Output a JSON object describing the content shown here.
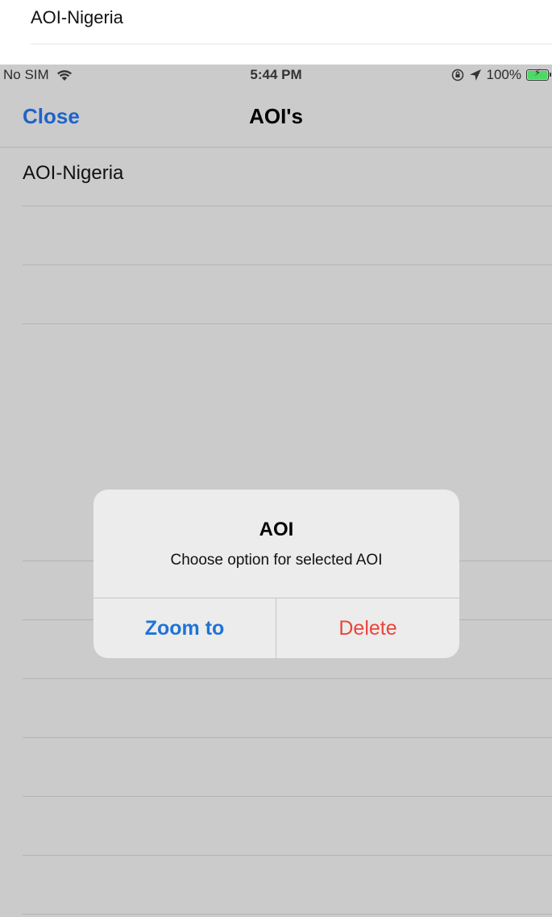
{
  "background_list": {
    "item": "AOI-Nigeria"
  },
  "status_bar": {
    "carrier": "No SIM",
    "time": "5:44 PM",
    "battery": "100%"
  },
  "nav": {
    "close_label": "Close",
    "title": "AOI's"
  },
  "list": {
    "items": [
      {
        "label": "AOI-Nigeria"
      }
    ]
  },
  "alert": {
    "title": "AOI",
    "message": "Choose option for selected AOI",
    "zoom_label": "Zoom to",
    "delete_label": "Delete"
  },
  "colors": {
    "accent": "#1e64c8",
    "destructive": "#e8453c",
    "battery": "#4cd964"
  }
}
